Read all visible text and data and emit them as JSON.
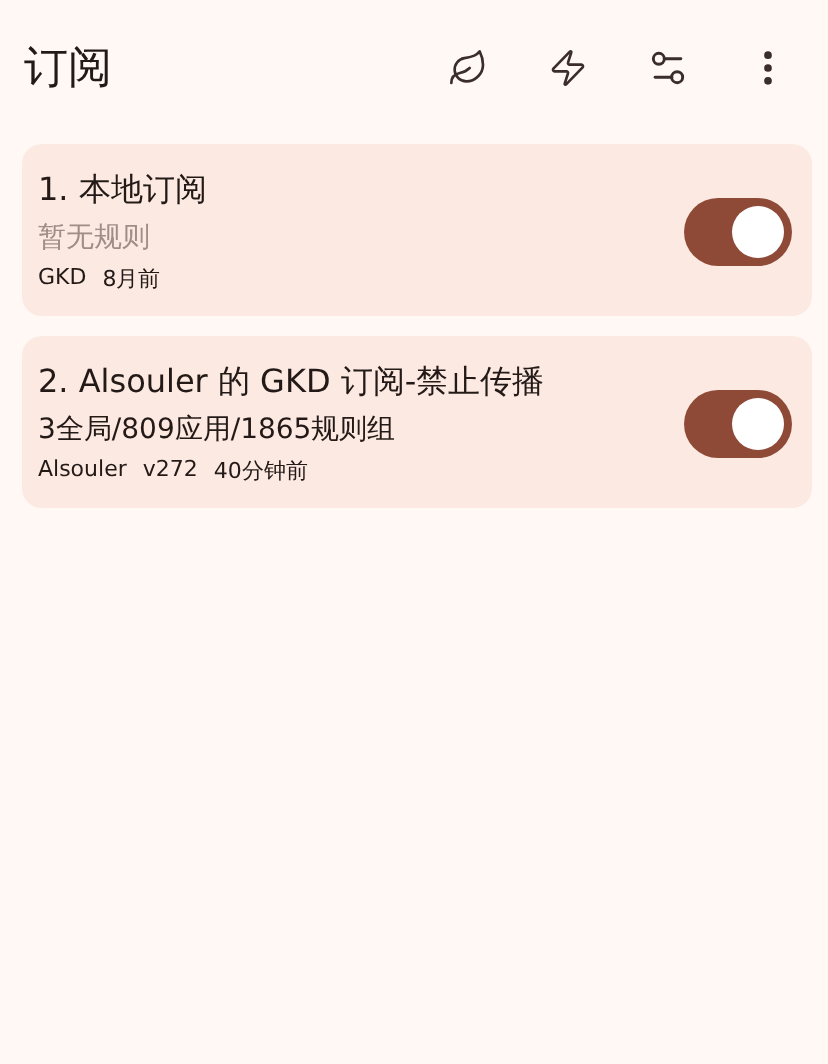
{
  "app_bar": {
    "title": "订阅"
  },
  "subscriptions": [
    {
      "title": "1. 本地订阅",
      "summary": "暂无规则",
      "summary_muted": true,
      "meta": [
        "GKD",
        "8月前"
      ],
      "on": true
    },
    {
      "title": "2. Alsouler 的 GKD 订阅-禁止传播",
      "summary": "3全局/809应用/1865规则组",
      "summary_muted": false,
      "meta": [
        "Alsouler",
        "v272",
        "40分钟前"
      ],
      "on": true
    }
  ]
}
